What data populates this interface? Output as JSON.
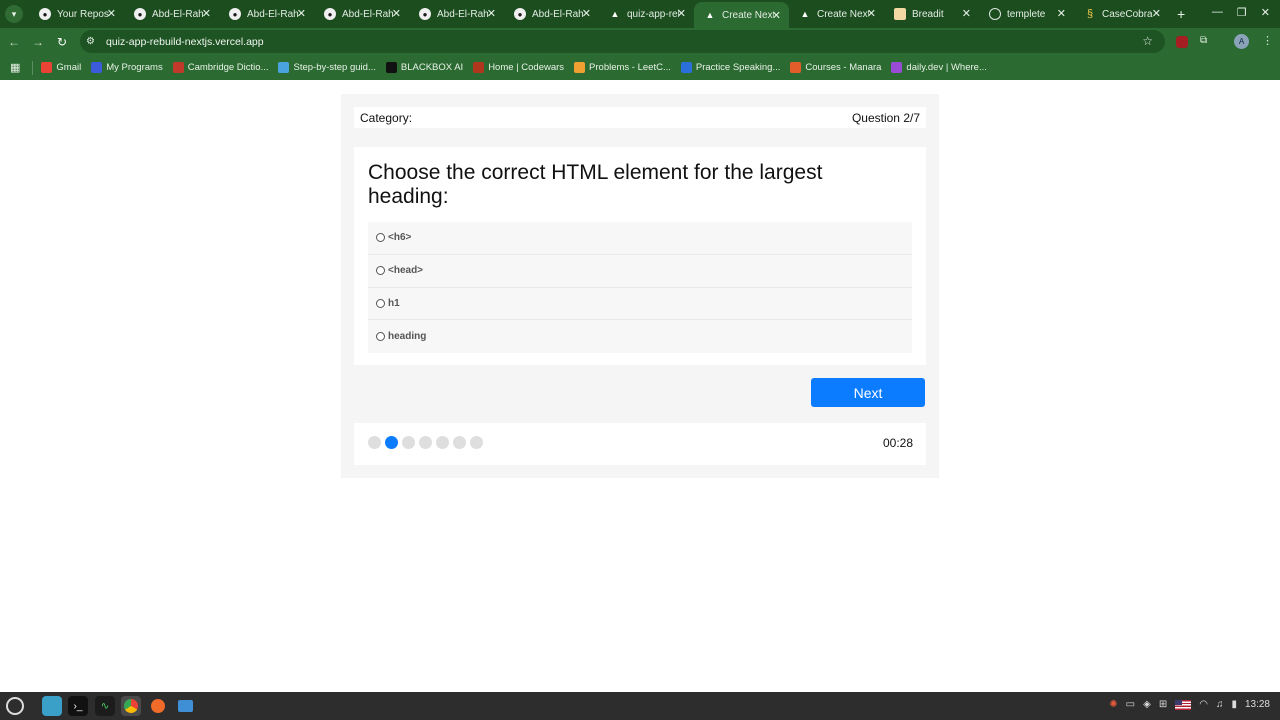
{
  "browser": {
    "tabs": [
      {
        "icon": "github-icon",
        "label": "Your Reposi",
        "active": false
      },
      {
        "icon": "github-icon",
        "label": "Abd-El-Rahm",
        "active": false
      },
      {
        "icon": "github-icon",
        "label": "Abd-El-Rahm",
        "active": false
      },
      {
        "icon": "github-icon",
        "label": "Abd-El-Rahm",
        "active": false
      },
      {
        "icon": "github-icon",
        "label": "Abd-El-Rahm",
        "active": false
      },
      {
        "icon": "github-icon",
        "label": "Abd-El-Rahm",
        "active": false
      },
      {
        "icon": "vercel-icon",
        "label": "quiz-app-reb",
        "active": false
      },
      {
        "icon": "vercel-icon",
        "label": "Create Next",
        "active": true
      },
      {
        "icon": "vercel-icon",
        "label": "Create Next",
        "active": false
      },
      {
        "icon": "bread-icon",
        "label": "Breadit",
        "active": false
      },
      {
        "icon": "globe-icon",
        "label": "templete",
        "active": false
      },
      {
        "icon": "cobra-icon",
        "label": "CaseCobra",
        "active": false
      }
    ],
    "url": "quiz-app-rebuild-nextjs.vercel.app",
    "profile_initial": "A",
    "bookmarks": [
      {
        "icon": "gmail-icon",
        "label": "Gmail",
        "color": "#ea4335"
      },
      {
        "icon": "programs-icon",
        "label": "My Programs",
        "color": "#3b5bdb"
      },
      {
        "icon": "cambridge-icon",
        "label": "Cambridge Dictio...",
        "color": "#c0392b"
      },
      {
        "icon": "guide-icon",
        "label": "Step-by-step guid...",
        "color": "#4aa3df"
      },
      {
        "icon": "blackbox-icon",
        "label": "BLACKBOX AI",
        "color": "#111111"
      },
      {
        "icon": "codewars-icon",
        "label": "Home | Codewars",
        "color": "#b1361e"
      },
      {
        "icon": "leetcode-icon",
        "label": "Problems - LeetC...",
        "color": "#f0a030"
      },
      {
        "icon": "speaking-icon",
        "label": "Practice Speaking...",
        "color": "#2a6fdb"
      },
      {
        "icon": "manara-icon",
        "label": "Courses - Manara",
        "color": "#e35d2a"
      },
      {
        "icon": "dailydev-icon",
        "label": "daily.dev | Where...",
        "color": "#9a4bd6"
      }
    ]
  },
  "quiz": {
    "category_label": "Category:",
    "question_counter": "Question 2/7",
    "question": "Choose the correct HTML element for the largest heading:",
    "options": [
      "<h6>",
      "<head>",
      "h1",
      "heading"
    ],
    "next_label": "Next",
    "progress": {
      "current": 2,
      "total": 7
    },
    "timer": "00:28",
    "accent_color": "#0b7bff"
  },
  "taskbar": {
    "clock": "13:28"
  }
}
